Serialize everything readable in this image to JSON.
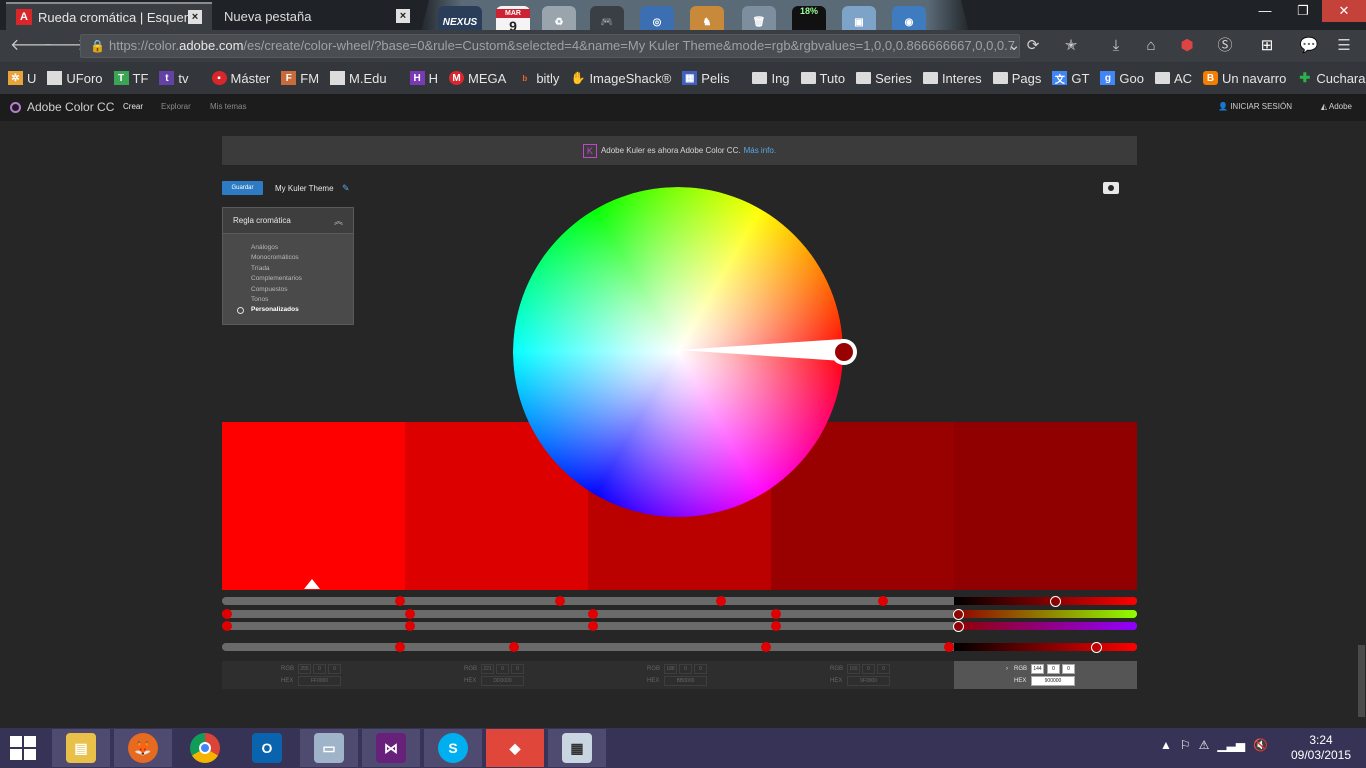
{
  "browser": {
    "tabs": [
      {
        "label": "Rueda cromática | Esquem...",
        "icon": "adobe-icon",
        "active": true
      },
      {
        "label": "Nueva pestaña",
        "active": false
      }
    ],
    "url_prefix": "https://color.",
    "url_domain": "adobe.com",
    "url_rest": "/es/create/color-wheel/?base=0&rule=Custom&selected=4&name=My Kuler Theme&mode=rgb&rgbvalues=1,0,0,0.866666667,0,0,0.7",
    "dock": {
      "nexus": "NEXUS",
      "calendar_month": "MAR",
      "calendar_day": "9",
      "cpu": "18%"
    },
    "bookmarks": [
      {
        "label": "U",
        "icon": "joomla-icon",
        "color": "#e8a33b"
      },
      {
        "label": "UForo",
        "icon": "page-icon",
        "color": "#dcdcdc"
      },
      {
        "label": "TF",
        "icon": "tf-icon",
        "color": "#3aa655"
      },
      {
        "label": "tv",
        "icon": "twitch-icon",
        "color": "#6441a5"
      },
      {
        "label": "Máster",
        "icon": "master-icon",
        "color": "#d8262b"
      },
      {
        "label": "FM",
        "icon": "fm-icon",
        "color": "#c86b3b"
      },
      {
        "label": "M.Edu",
        "icon": "page-icon",
        "color": "#dcdcdc"
      },
      {
        "label": "H",
        "icon": "h-icon",
        "color": "#7a3ab5"
      },
      {
        "label": "MEGA",
        "icon": "mega-icon",
        "color": "#d9272e"
      },
      {
        "label": "bitly",
        "icon": "bitly-icon",
        "color": "#ee6123"
      },
      {
        "label": "ImageShack®",
        "icon": "imageshack-icon",
        "color": "#f5b700"
      },
      {
        "label": "Pelis",
        "icon": "film-icon",
        "color": "#4060c0"
      },
      {
        "label": "Ing",
        "icon": "folder-icon"
      },
      {
        "label": "Tuto",
        "icon": "folder-icon"
      },
      {
        "label": "Series",
        "icon": "folder-icon"
      },
      {
        "label": "Interes",
        "icon": "folder-icon"
      },
      {
        "label": "Pags",
        "icon": "folder-icon"
      },
      {
        "label": "GT",
        "icon": "translate-icon",
        "color": "#4285f4"
      },
      {
        "label": "Goo",
        "icon": "google-icon",
        "color": "#4285f4"
      },
      {
        "label": "AC",
        "icon": "folder-icon"
      },
      {
        "label": "Un navarro",
        "icon": "blogger-icon",
        "color": "#f57d00"
      },
      {
        "label": "Cuchara",
        "icon": "feedly-icon",
        "color": "#2bb24c"
      }
    ]
  },
  "app": {
    "brand": "Adobe Color CC",
    "nav": [
      "Crear",
      "Explorar",
      "Mis temas"
    ],
    "signin": "INICIAR SESIÓN",
    "adobe": "Adobe",
    "banner_text": "Adobe Kuler es ahora Adobe Color CC.",
    "banner_link": "Más info.",
    "save_label": "Guardar",
    "theme_name": "My Kuler Theme",
    "rule_title": "Regla cromática",
    "rules": [
      "Análogos",
      "Monocromáticos",
      "Tríada",
      "Complementarios",
      "Compuestos",
      "Tonos",
      "Personalizados"
    ],
    "selected_rule": "Personalizados",
    "swatches": [
      "#ff0000",
      "#dd0000",
      "#bb0000",
      "#990000",
      "#900000"
    ],
    "info": [
      {
        "rgb": [
          "255",
          "0",
          "0"
        ],
        "hex": "FF0000"
      },
      {
        "rgb": [
          "221",
          "0",
          "0"
        ],
        "hex": "DD0000"
      },
      {
        "rgb": [
          "188",
          "0",
          "0"
        ],
        "hex": "BB0000"
      },
      {
        "rgb": [
          "155",
          "0",
          "0"
        ],
        "hex": "9F0000"
      },
      {
        "rgb": [
          "144",
          "0",
          "0"
        ],
        "hex": "900000"
      }
    ],
    "rgb_label": "RGB",
    "hex_label": "HEX"
  },
  "taskbar": {
    "time": "3:24",
    "date": "09/03/2015"
  }
}
